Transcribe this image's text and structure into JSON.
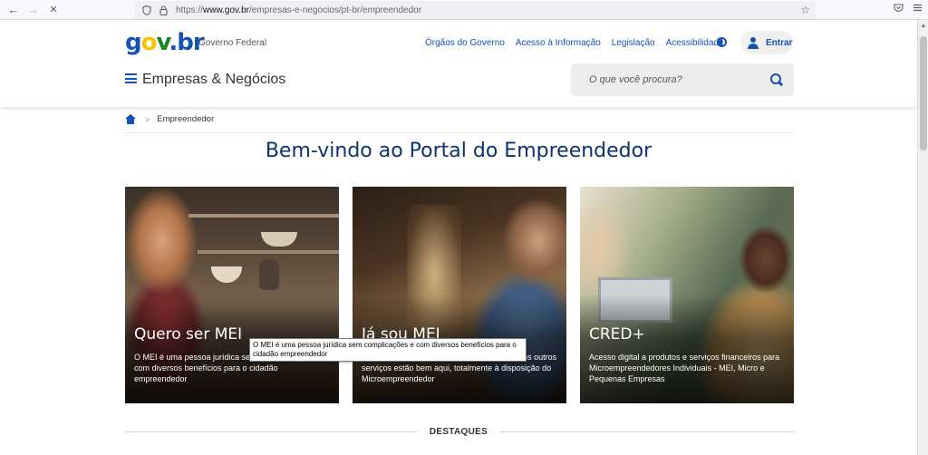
{
  "browser": {
    "url_prefix": "https://",
    "url_domain": "www.gov.br",
    "url_path": "/empresas-e-negocios/pt-br/empreendedor",
    "back_icon": "←",
    "forward_icon": "→",
    "stop_icon": "✕",
    "star_icon": "☆"
  },
  "header": {
    "logo_g": "g",
    "logo_o": "o",
    "logo_v": "v",
    "logo_dot": ".",
    "logo_br": "br",
    "gov_label": "Governo Federal",
    "links": [
      "Órgãos do Governo",
      "Acesso à Informação",
      "Legislação",
      "Acessibilidade"
    ],
    "login_label": "Entrar",
    "site_title": "Empresas & Negócios",
    "search_placeholder": "O que você procura?"
  },
  "breadcrumb": {
    "separator": ">",
    "current": "Empreendedor"
  },
  "page": {
    "title": "Bem-vindo ao Portal do Empreendedor"
  },
  "cards": [
    {
      "title": "Quero ser MEI",
      "description": "O MEI é uma pessoa jurídica sem complicações e com diversos benefícios para o cidadão empreendedor"
    },
    {
      "title": "Já sou MEI",
      "description": "Declarações, pagamentos, alterações e muitos outros serviços estão bem aqui, totalmente à disposição do Microempreendedor"
    },
    {
      "title": "CRED+",
      "description": "Acesso digital a produtos e serviços financeiros para Microempreendedores Individuais - MEI, Micro e Pequenas Empresas"
    }
  ],
  "tooltip": {
    "text": "O MEI é uma pessoa jurídica sem complicações e com diversos benefícios para o cidadão empreendedor"
  },
  "destaques": {
    "label": "DESTAQUES"
  },
  "colors": {
    "primary": "#1351b4",
    "title": "#0c326f"
  }
}
